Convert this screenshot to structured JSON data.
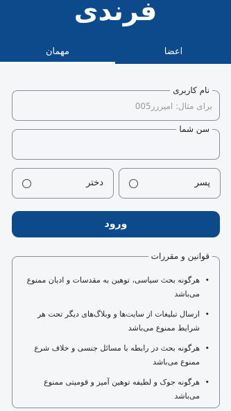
{
  "app": {
    "logo_text": "فرندی"
  },
  "tabs": [
    {
      "label": "مهمان",
      "active": true
    },
    {
      "label": "اعضا",
      "active": false
    }
  ],
  "form": {
    "username_label": "نام کاربری",
    "username_placeholder": "برای مثال: امیررر005",
    "age_label": "سن شما",
    "gender_options": [
      {
        "label": "پسر",
        "selected": false
      },
      {
        "label": "دختر",
        "selected": false
      }
    ],
    "submit_label": "ورود"
  },
  "rules": {
    "title": "قوانین و مقررات",
    "items": [
      "هرگونه بحث سیاسی، توهین به مقدسات و ادیان ممنوع می‌باشد",
      "ارسال تبلیغات از سایت‌ها و وبلاگ‌های دیگر تحت هر شرایط ممنوع می‌باشد",
      "هرگونه بحث در رابطه با مسائل جنسی و خلاف شرع ممنوع می‌باشد",
      "هرگونه جوک و لطیفه توهین آمیز و قومیتی ممنوع می‌باشد"
    ]
  },
  "colors": {
    "primary": "#0c4a8c",
    "background": "#f5f6f8"
  }
}
